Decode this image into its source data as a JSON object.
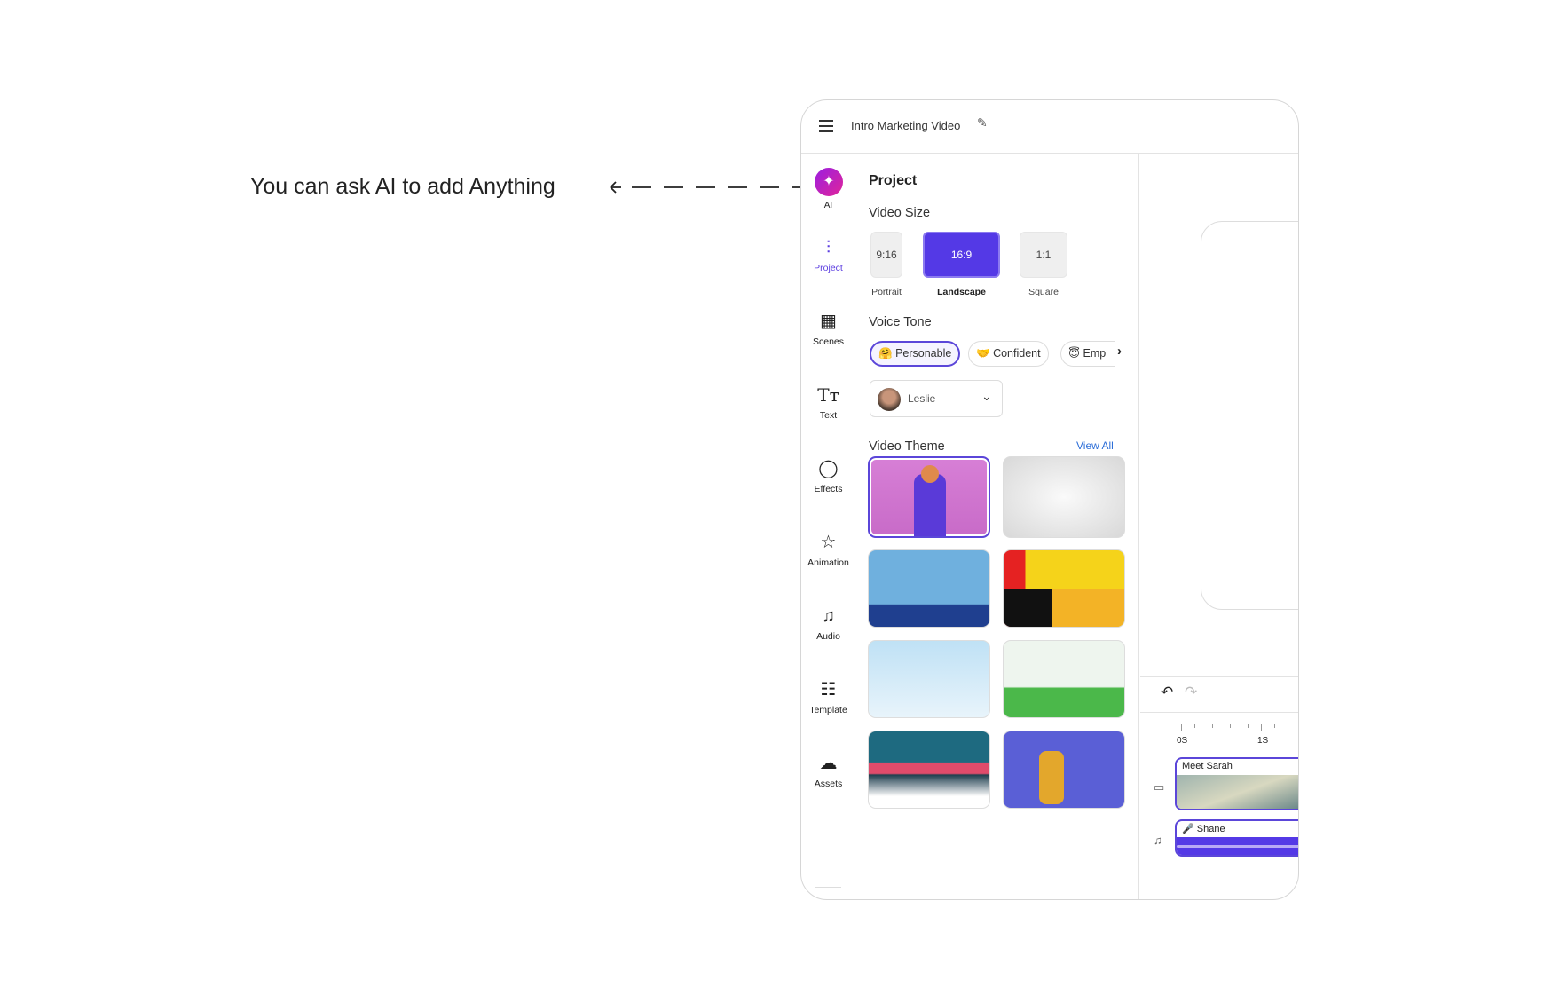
{
  "callout": {
    "text": "You can ask AI to add Anything"
  },
  "header": {
    "title": "Intro Marketing Video"
  },
  "sidebar": {
    "ai_label": "AI",
    "items": [
      {
        "label": "Project",
        "icon": "sliders-icon",
        "active": true
      },
      {
        "label": "Scenes",
        "icon": "clapperboard-icon"
      },
      {
        "label": "Text",
        "icon": "text-size-icon"
      },
      {
        "label": "Effects",
        "icon": "crystal-ball-icon"
      },
      {
        "label": "Animation",
        "icon": "shooting-star-icon"
      },
      {
        "label": "Audio",
        "icon": "music-note-icon"
      },
      {
        "label": "Template",
        "icon": "template-icon"
      },
      {
        "label": "Assets",
        "icon": "cloud-upload-icon"
      }
    ]
  },
  "panel": {
    "title": "Project",
    "video_size": {
      "heading": "Video Size",
      "options": [
        {
          "ratio": "9:16",
          "label": "Portrait"
        },
        {
          "ratio": "16:9",
          "label": "Landscape",
          "selected": true
        },
        {
          "ratio": "1:1",
          "label": "Square"
        }
      ]
    },
    "voice_tone": {
      "heading": "Voice Tone",
      "chips": [
        {
          "emoji": "🤗",
          "label": "Personable",
          "selected": true
        },
        {
          "emoji": "🤝",
          "label": "Confident"
        },
        {
          "emoji": "😇",
          "label": "Emp"
        }
      ],
      "voice": "Leslie"
    },
    "video_theme": {
      "heading": "Video Theme",
      "view_all": "View All"
    }
  },
  "timeline": {
    "ruler": [
      "0S",
      "1S"
    ],
    "tracks": [
      {
        "label": "Meet Sarah",
        "type": "video"
      },
      {
        "label": "Shane",
        "type": "audio"
      }
    ]
  },
  "colors": {
    "accent": "#5439e6",
    "link": "#2e6fd8"
  }
}
